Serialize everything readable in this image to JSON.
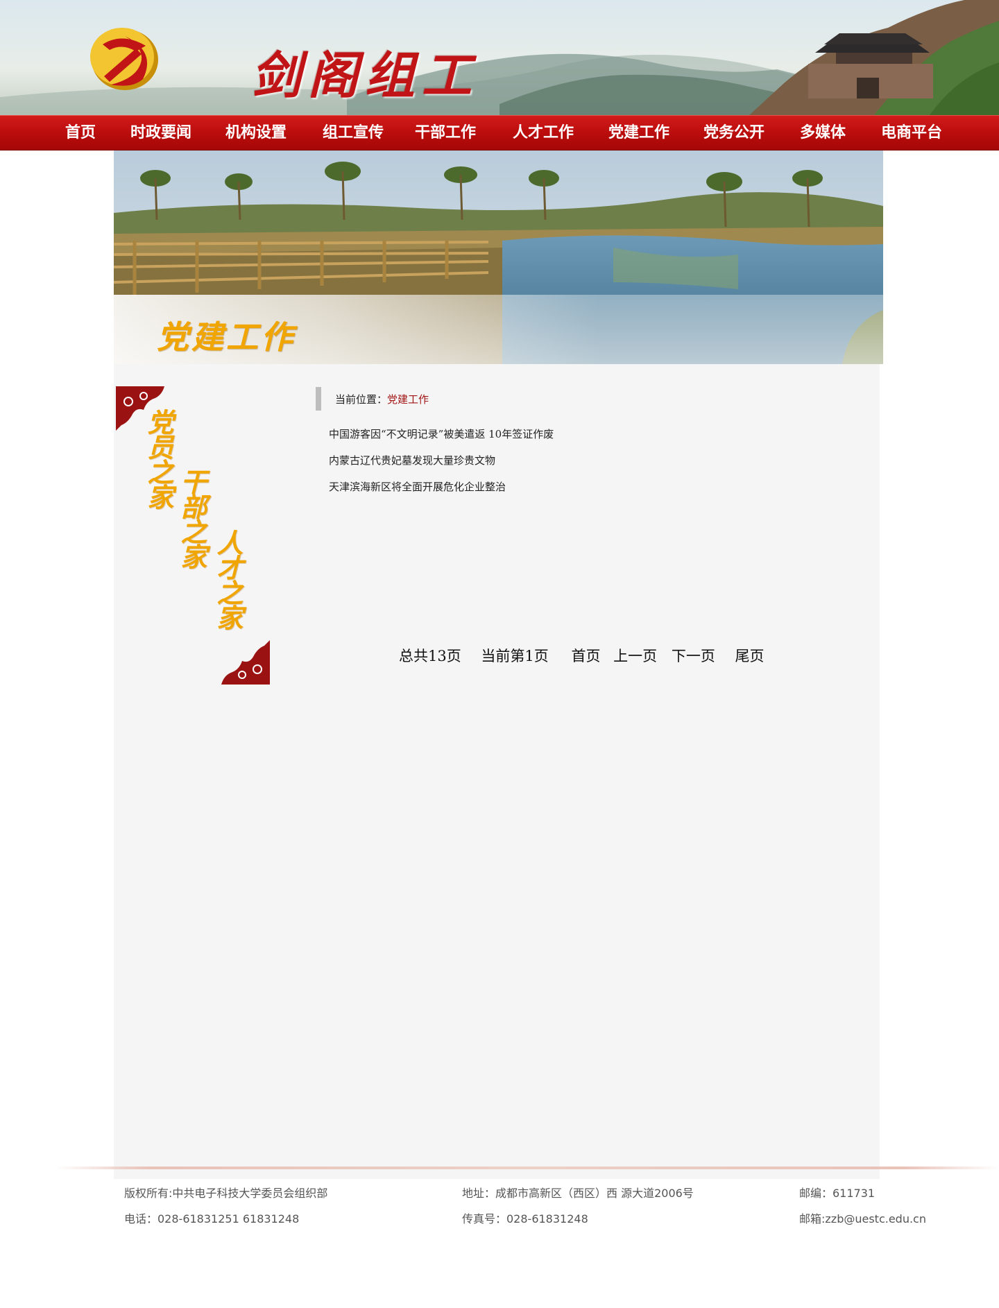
{
  "header": {
    "site_title": "剑阁组工",
    "logo_icon": "party-emblem-icon"
  },
  "nav": {
    "items": [
      {
        "label": "首页"
      },
      {
        "label": "时政要闻"
      },
      {
        "label": "机构设置"
      },
      {
        "label": "组工宣传"
      },
      {
        "label": "干部工作"
      },
      {
        "label": "人才工作"
      },
      {
        "label": "党建工作"
      },
      {
        "label": "党务公开"
      },
      {
        "label": "多媒体"
      },
      {
        "label": "电商平台"
      }
    ]
  },
  "banner": {
    "caption": "党建工作"
  },
  "sidebar": {
    "phrases": [
      "党员之家",
      "干部之家",
      "人才之家"
    ]
  },
  "location": {
    "label": "当前位置：",
    "current": "党建工作"
  },
  "news": {
    "items": [
      {
        "title": "中国游客因“不文明记录”被美遣返 10年签证作废"
      },
      {
        "title": "内蒙古辽代贵妃墓发现大量珍贵文物"
      },
      {
        "title": "天津滨海新区将全面开展危化企业整治"
      }
    ]
  },
  "pagination": {
    "total": "总共13页",
    "current": "当前第1页",
    "first": "首页",
    "prev": "上一页",
    "next": "下一页",
    "last": "尾页"
  },
  "footer": {
    "copyright": "版权所有:中共电子科技大学委员会组织部",
    "address": "地址：成都市高新区（西区）西 源大道2006号",
    "postcode": "邮编：611731",
    "phone": "电话：028-61831251 61831248",
    "fax": "传真号：028-61831248",
    "email": "邮箱:zzb@uestc.edu.cn"
  },
  "colors": {
    "nav_red": "#b90c0c",
    "title_red": "#c01416",
    "accent_gold": "#f0a500",
    "content_bg": "#f5f5f5",
    "location_red": "#a11414"
  }
}
